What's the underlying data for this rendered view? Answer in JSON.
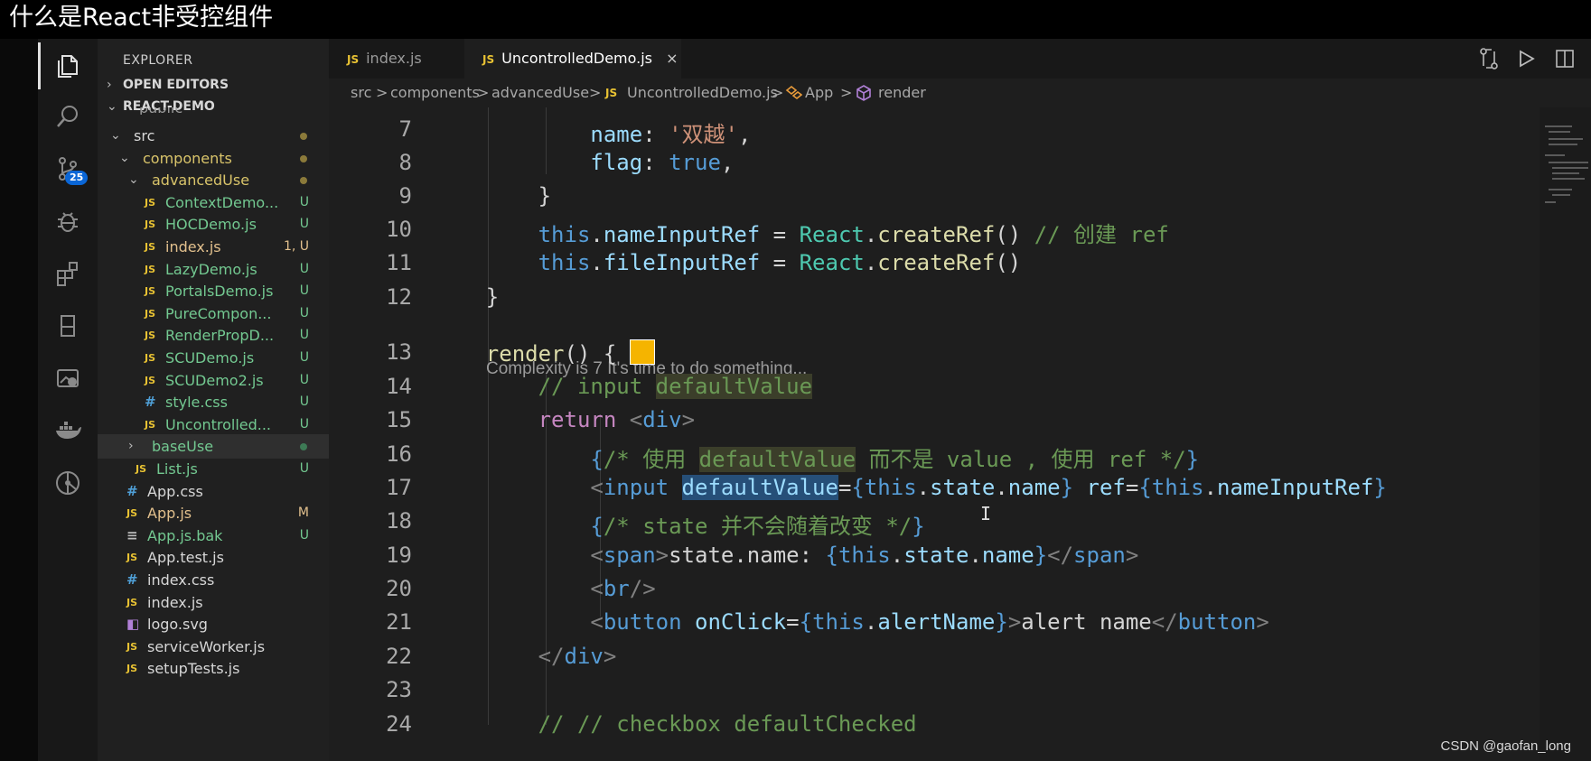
{
  "banner": {
    "title": "什么是React非受控组件"
  },
  "activity_bar": {
    "scm_badge": "25",
    "icons": [
      "explorer-icon",
      "search-icon",
      "source-control-icon",
      "debug-icon",
      "extensions-icon",
      "book-icon",
      "remote-explorer-icon",
      "docker-icon",
      "gitlens-icon"
    ]
  },
  "sidebar": {
    "title": "EXPLORER",
    "open_editors": "OPEN EDITORS",
    "project": "REACT-DEMO",
    "partial_top": "public",
    "items": [
      {
        "name": "src",
        "type": "folder",
        "expanded": true,
        "depth": 1,
        "status": "",
        "color": "#d7d7d7",
        "dot": "#8b7a3a"
      },
      {
        "name": "components",
        "type": "folder",
        "expanded": true,
        "depth": 2,
        "status": "",
        "color": "#d9c46a",
        "dot": "#8b7a3a"
      },
      {
        "name": "advancedUse",
        "type": "folder",
        "expanded": true,
        "depth": 3,
        "status": "",
        "color": "#d9c46a",
        "dot": "#8b7a3a"
      },
      {
        "name": "ContextDemo...",
        "type": "js",
        "depth": 4,
        "status": "U",
        "color": "#73c991"
      },
      {
        "name": "HOCDemo.js",
        "type": "js",
        "depth": 4,
        "status": "U",
        "color": "#73c991"
      },
      {
        "name": "index.js",
        "type": "js",
        "depth": 4,
        "status": "1, U",
        "color": "#e2c08d"
      },
      {
        "name": "LazyDemo.js",
        "type": "js",
        "depth": 4,
        "status": "U",
        "color": "#73c991"
      },
      {
        "name": "PortalsDemo.js",
        "type": "js",
        "depth": 4,
        "status": "U",
        "color": "#73c991"
      },
      {
        "name": "PureCompon...",
        "type": "js",
        "depth": 4,
        "status": "U",
        "color": "#73c991"
      },
      {
        "name": "RenderPropD...",
        "type": "js",
        "depth": 4,
        "status": "U",
        "color": "#73c991"
      },
      {
        "name": "SCUDemo.js",
        "type": "js",
        "depth": 4,
        "status": "U",
        "color": "#73c991"
      },
      {
        "name": "SCUDemo2.js",
        "type": "js",
        "depth": 4,
        "status": "U",
        "color": "#73c991"
      },
      {
        "name": "style.css",
        "type": "css",
        "depth": 4,
        "status": "U",
        "color": "#73c991"
      },
      {
        "name": "Uncontrolled...",
        "type": "js",
        "depth": 4,
        "status": "U",
        "color": "#73c991"
      },
      {
        "name": "baseUse",
        "type": "folder",
        "expanded": false,
        "depth": 3,
        "status": "",
        "color": "#73c991",
        "dot": "#3d7a55",
        "selected": true
      },
      {
        "name": "List.js",
        "type": "js",
        "depth": 3,
        "status": "U",
        "color": "#73c991"
      },
      {
        "name": "App.css",
        "type": "css",
        "depth": 2,
        "status": "",
        "color": "#d7d7d7"
      },
      {
        "name": "App.js",
        "type": "js",
        "depth": 2,
        "status": "M",
        "color": "#e2c08d"
      },
      {
        "name": "App.js.bak",
        "type": "txt",
        "depth": 2,
        "status": "U",
        "color": "#73c991"
      },
      {
        "name": "App.test.js",
        "type": "js",
        "depth": 2,
        "status": "",
        "color": "#d7d7d7"
      },
      {
        "name": "index.css",
        "type": "css",
        "depth": 2,
        "status": "",
        "color": "#d7d7d7"
      },
      {
        "name": "index.js",
        "type": "js",
        "depth": 2,
        "status": "",
        "color": "#d7d7d7"
      },
      {
        "name": "logo.svg",
        "type": "svg",
        "depth": 2,
        "status": "",
        "color": "#d7d7d7"
      },
      {
        "name": "serviceWorker.js",
        "type": "js",
        "depth": 2,
        "status": "",
        "color": "#d7d7d7"
      },
      {
        "name": "setupTests.js",
        "type": "js",
        "depth": 2,
        "status": "",
        "color": "#d7d7d7"
      }
    ]
  },
  "tabs": [
    {
      "label": "index.js",
      "active": false
    },
    {
      "label": "UncontrolledDemo.js",
      "active": true,
      "close": "×"
    }
  ],
  "breadcrumb": {
    "parts": [
      "src",
      ">",
      "components",
      ">",
      "advancedUse",
      ">",
      "JS",
      "UncontrolledDemo.js",
      ">",
      "App",
      ">",
      "render"
    ]
  },
  "code": {
    "lens": "Complexity is 7 It's time to do something...",
    "lines": [
      {
        "n": "7",
        "tokens": [
          {
            "t": "            "
          },
          {
            "t": "name",
            "c": "k-prop"
          },
          {
            "t": ": "
          },
          {
            "t": "'双越'",
            "c": "k-str"
          },
          {
            "t": ","
          }
        ]
      },
      {
        "n": "8",
        "tokens": [
          {
            "t": "            "
          },
          {
            "t": "flag",
            "c": "k-prop"
          },
          {
            "t": ": "
          },
          {
            "t": "true",
            "c": "k-kw"
          },
          {
            "t": ","
          }
        ]
      },
      {
        "n": "9",
        "tokens": [
          {
            "t": "        }"
          }
        ]
      },
      {
        "n": "10",
        "tokens": [
          {
            "t": "        "
          },
          {
            "t": "this",
            "c": "k-this"
          },
          {
            "t": "."
          },
          {
            "t": "nameInputRef",
            "c": "k-prop"
          },
          {
            "t": " = "
          },
          {
            "t": "React",
            "c": "k-cls"
          },
          {
            "t": "."
          },
          {
            "t": "createRef",
            "c": "k-fn"
          },
          {
            "t": "() "
          },
          {
            "t": "// 创建 ref",
            "c": "k-cmt"
          }
        ]
      },
      {
        "n": "11",
        "tokens": [
          {
            "t": "        "
          },
          {
            "t": "this",
            "c": "k-this"
          },
          {
            "t": "."
          },
          {
            "t": "fileInputRef",
            "c": "k-prop"
          },
          {
            "t": " = "
          },
          {
            "t": "React",
            "c": "k-cls"
          },
          {
            "t": "."
          },
          {
            "t": "createRef",
            "c": "k-fn"
          },
          {
            "t": "()"
          }
        ]
      },
      {
        "n": "12",
        "tokens": [
          {
            "t": "    }"
          }
        ]
      },
      {
        "n": "13",
        "tokens": [
          {
            "t": "    "
          },
          {
            "t": "render",
            "c": "k-fn"
          },
          {
            "t": "() { "
          },
          {
            "t": "",
            "box": true
          }
        ]
      },
      {
        "n": "14",
        "tokens": [
          {
            "t": "        "
          },
          {
            "t": "// input ",
            "c": "k-cmt"
          },
          {
            "t": "defaultValue",
            "c": "k-cmt hl-word"
          }
        ]
      },
      {
        "n": "15",
        "tokens": [
          {
            "t": "        "
          },
          {
            "t": "return",
            "c": "k-ctl"
          },
          {
            "t": " "
          },
          {
            "t": "<",
            "c": "k-br"
          },
          {
            "t": "div",
            "c": "k-tag"
          },
          {
            "t": ">",
            "c": "k-br"
          }
        ]
      },
      {
        "n": "16",
        "tokens": [
          {
            "t": "            "
          },
          {
            "t": "{",
            "c": "k-jsx"
          },
          {
            "t": "/* 使用 ",
            "c": "k-cmt"
          },
          {
            "t": "defaultValue",
            "c": "k-cmt hl-word"
          },
          {
            "t": " 而不是 value , 使用 ref */",
            "c": "k-cmt"
          },
          {
            "t": "}",
            "c": "k-jsx"
          }
        ]
      },
      {
        "n": "17",
        "tokens": [
          {
            "t": "            "
          },
          {
            "t": "<",
            "c": "k-br"
          },
          {
            "t": "input",
            "c": "k-tag"
          },
          {
            "t": " "
          },
          {
            "t": "defaultValue",
            "c": "k-attr hl-sel"
          },
          {
            "t": "="
          },
          {
            "t": "{",
            "c": "k-jsx"
          },
          {
            "t": "this",
            "c": "k-this"
          },
          {
            "t": "."
          },
          {
            "t": "state",
            "c": "k-prop"
          },
          {
            "t": "."
          },
          {
            "t": "name",
            "c": "k-prop"
          },
          {
            "t": "}",
            "c": "k-jsx"
          },
          {
            "t": " "
          },
          {
            "t": "ref",
            "c": "k-attr"
          },
          {
            "t": "="
          },
          {
            "t": "{",
            "c": "k-jsx"
          },
          {
            "t": "this",
            "c": "k-this"
          },
          {
            "t": "."
          },
          {
            "t": "nameInputRef",
            "c": "k-prop"
          },
          {
            "t": "}",
            "c": "k-jsx"
          }
        ]
      },
      {
        "n": "18",
        "tokens": [
          {
            "t": "            "
          },
          {
            "t": "{",
            "c": "k-jsx"
          },
          {
            "t": "/* state 并不会随着改变 */",
            "c": "k-cmt"
          },
          {
            "t": "}",
            "c": "k-jsx"
          }
        ]
      },
      {
        "n": "19",
        "tokens": [
          {
            "t": "            "
          },
          {
            "t": "<",
            "c": "k-br"
          },
          {
            "t": "span",
            "c": "k-tag"
          },
          {
            "t": ">",
            "c": "k-br"
          },
          {
            "t": "state.name: "
          },
          {
            "t": "{",
            "c": "k-jsx"
          },
          {
            "t": "this",
            "c": "k-this"
          },
          {
            "t": "."
          },
          {
            "t": "state",
            "c": "k-prop"
          },
          {
            "t": "."
          },
          {
            "t": "name",
            "c": "k-prop"
          },
          {
            "t": "}",
            "c": "k-jsx"
          },
          {
            "t": "</",
            "c": "k-br"
          },
          {
            "t": "span",
            "c": "k-tag"
          },
          {
            "t": ">",
            "c": "k-br"
          }
        ]
      },
      {
        "n": "20",
        "tokens": [
          {
            "t": "            "
          },
          {
            "t": "<",
            "c": "k-br"
          },
          {
            "t": "br",
            "c": "k-tag"
          },
          {
            "t": "/>",
            "c": "k-br"
          }
        ]
      },
      {
        "n": "21",
        "tokens": [
          {
            "t": "            "
          },
          {
            "t": "<",
            "c": "k-br"
          },
          {
            "t": "button",
            "c": "k-tag"
          },
          {
            "t": " "
          },
          {
            "t": "onClick",
            "c": "k-attr"
          },
          {
            "t": "="
          },
          {
            "t": "{",
            "c": "k-jsx"
          },
          {
            "t": "this",
            "c": "k-this"
          },
          {
            "t": "."
          },
          {
            "t": "alertName",
            "c": "k-prop"
          },
          {
            "t": "}",
            "c": "k-jsx"
          },
          {
            "t": ">",
            "c": "k-br"
          },
          {
            "t": "alert name"
          },
          {
            "t": "</",
            "c": "k-br"
          },
          {
            "t": "button",
            "c": "k-tag"
          },
          {
            "t": ">",
            "c": "k-br"
          }
        ]
      },
      {
        "n": "22",
        "tokens": [
          {
            "t": "        "
          },
          {
            "t": "</",
            "c": "k-br"
          },
          {
            "t": "div",
            "c": "k-tag"
          },
          {
            "t": ">",
            "c": "k-br"
          }
        ]
      },
      {
        "n": "23",
        "tokens": [
          {
            "t": ""
          }
        ]
      },
      {
        "n": "24",
        "tokens": [
          {
            "t": "        "
          },
          {
            "t": "// // checkbox defaultChecked",
            "c": "k-cmt"
          }
        ]
      }
    ]
  },
  "watermark": "CSDN @gaofan_long",
  "colors": {
    "accent": "#0a66d6",
    "editor_bg": "#1e1e1e",
    "sidebar_bg": "#202020",
    "untracked": "#73c991",
    "modified": "#e2c08d"
  }
}
